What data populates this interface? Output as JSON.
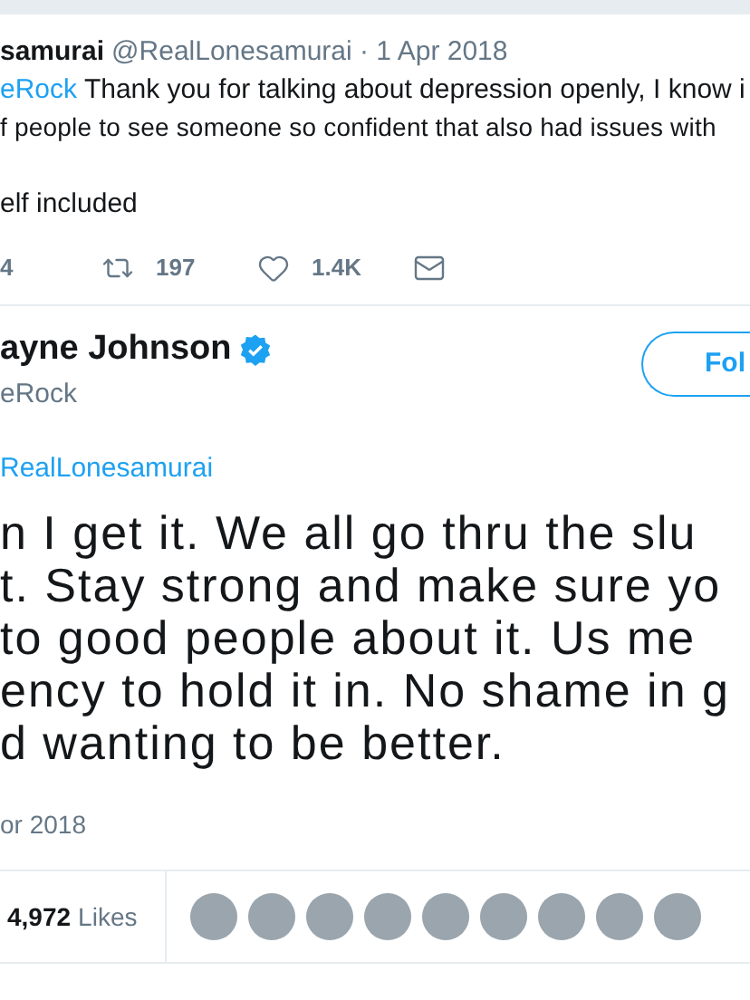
{
  "reply_tweet": {
    "name": "samurai",
    "handle": "@RealLonesamurai · 1 Apr 2018",
    "mention": "eRock",
    "text_lines": [
      "Thank you for talking about depression openly, I know i",
      "f people to see someone so confident that also had issues with"
    ],
    "text_end": "elf included",
    "actions": [
      {
        "kind": "reply",
        "count": "4"
      },
      {
        "kind": "retweet",
        "count": "197"
      },
      {
        "kind": "like",
        "count": "1.4K"
      },
      {
        "kind": "message"
      }
    ]
  },
  "main_tweet": {
    "name": "ayne Johnson",
    "verified": true,
    "handle": "eRock",
    "follow_button": "Fol",
    "replying_to": "RealLonesamurai",
    "text_lines": [
      "n I get it. We all go thru the slu",
      "t. Stay strong and make sure yo",
      "to good people about it. Us me",
      "ency to hold it in. No shame in g",
      "d wanting to be better."
    ],
    "date": "or 2018",
    "likes_count": "4,972",
    "likes_label": "Likes"
  }
}
